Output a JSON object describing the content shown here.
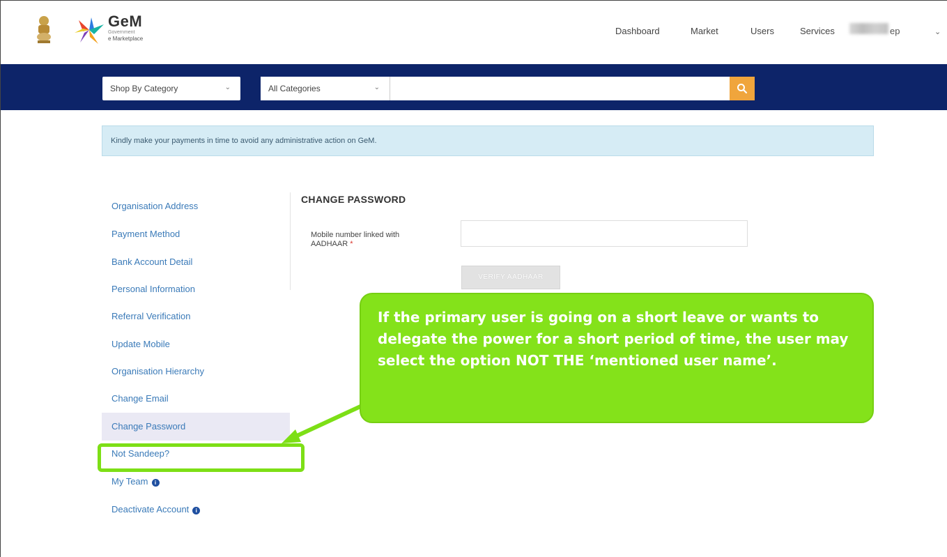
{
  "header": {
    "logo_title": "GeM",
    "logo_sub1": "Government",
    "logo_sub2": "e Marketplace",
    "nav": [
      "Dashboard",
      "Market",
      "Users",
      "Services"
    ],
    "user_name_partial": "ep"
  },
  "search": {
    "shop_by_category": "Shop By Category",
    "all_categories": "All Categories",
    "query": ""
  },
  "notice": "Kindly make your payments in time to avoid any administrative action on GeM.",
  "sidemenu": {
    "items": [
      "Organisation Address",
      "Payment Method",
      "Bank Account Detail",
      "Personal Information",
      "Referral Verification",
      "Update Mobile",
      "Organisation Hierarchy",
      "Change Email",
      "Change Password",
      "Not Sandeep?",
      "My Team",
      "Deactivate Account"
    ],
    "active": "Change Password"
  },
  "change_password": {
    "title": "CHANGE PASSWORD",
    "label_line1": "Mobile number linked with",
    "label_line2": "AADHAAR",
    "required_mark": "*",
    "mobile_value": "",
    "verify_button": "VERIFY AADHAAR"
  },
  "callout": {
    "text": "If the primary user is going on a short leave or wants to delegate the power for a short period of time, the user may select the option NOT THE ‘mentioned user name’."
  },
  "colors": {
    "navy_bar": "#0d2469",
    "search_button": "#f0a53c",
    "callout_green": "#84e21a",
    "link_blue": "#3a7ab8"
  }
}
